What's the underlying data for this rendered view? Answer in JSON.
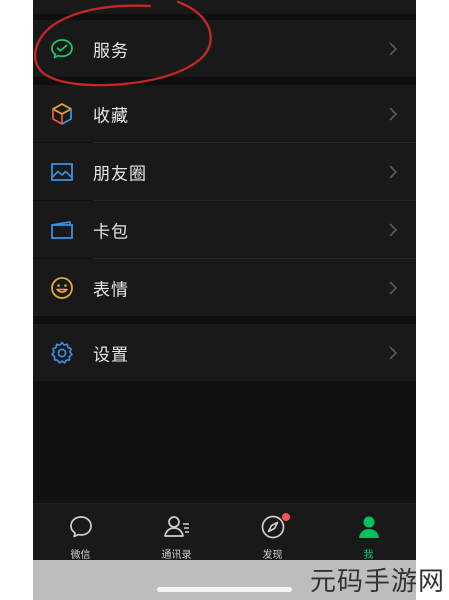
{
  "menu": {
    "items": [
      {
        "label": "服务",
        "icon": "wechat-pay-icon"
      },
      {
        "label": "收藏",
        "icon": "cube-icon"
      },
      {
        "label": "朋友圈",
        "icon": "image-icon"
      },
      {
        "label": "卡包",
        "icon": "card-icon"
      },
      {
        "label": "表情",
        "icon": "smile-icon"
      },
      {
        "label": "设置",
        "icon": "gear-icon"
      }
    ]
  },
  "tabbar": {
    "tabs": [
      {
        "label": "微信",
        "icon": "chat-bubble-icon"
      },
      {
        "label": "通讯录",
        "icon": "contacts-icon"
      },
      {
        "label": "发现",
        "icon": "compass-icon"
      },
      {
        "label": "我",
        "icon": "person-icon"
      }
    ],
    "active_color": "#07c160",
    "badge_color": "#fa5151"
  },
  "watermark": "元码手游网",
  "colors": {
    "background": "#111111",
    "cell": "#191919",
    "annotation": "#c0262a"
  }
}
